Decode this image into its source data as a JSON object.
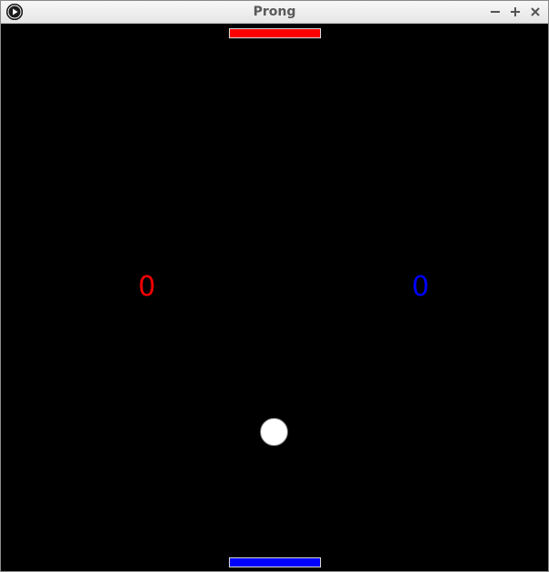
{
  "window": {
    "title": "Prong",
    "app_icon": "play-icon",
    "controls": {
      "minimize_icon": "minimize-icon",
      "maximize_icon": "maximize-icon",
      "close_icon": "close-icon"
    }
  },
  "game": {
    "background_color": "#000000",
    "top_paddle": {
      "color": "#ff0000"
    },
    "bottom_paddle": {
      "color": "#0000ff"
    },
    "ball": {
      "color": "#ffffff"
    },
    "scores": {
      "left": {
        "value": "0",
        "color": "#ff0000"
      },
      "right": {
        "value": "0",
        "color": "#0000ff"
      }
    }
  }
}
